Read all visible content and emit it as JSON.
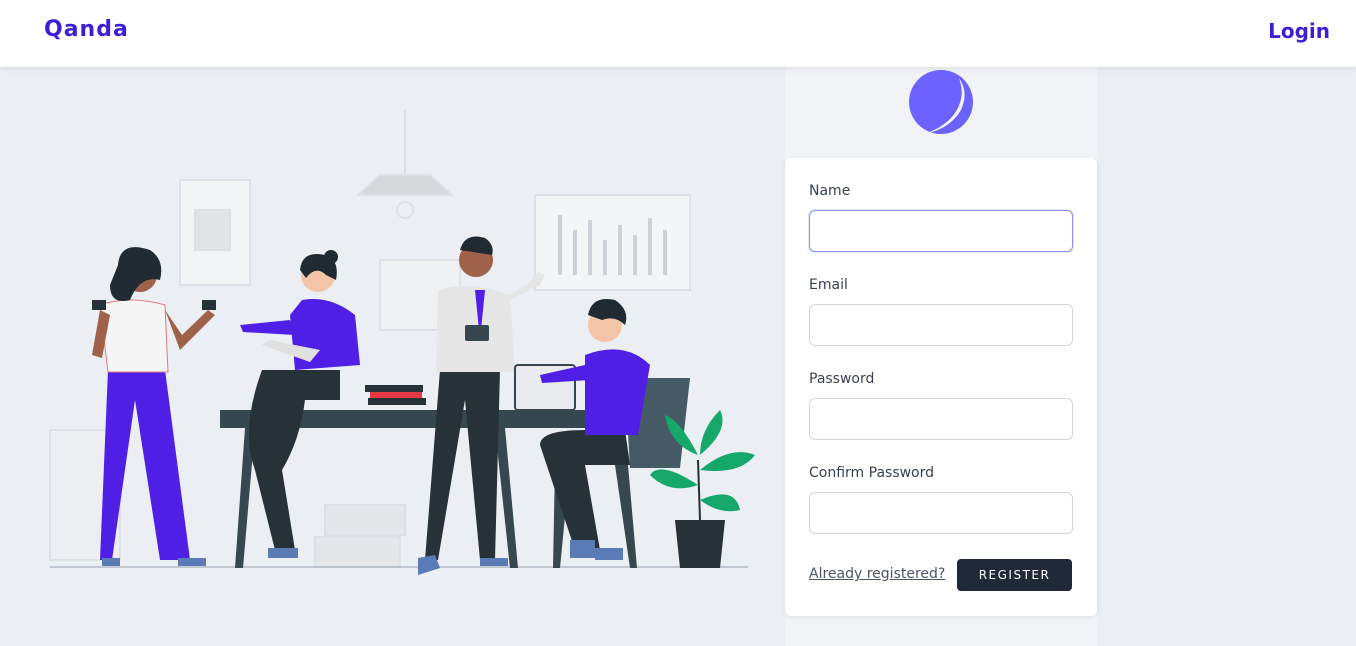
{
  "navbar": {
    "brand": "Qanda",
    "login_label": "Login"
  },
  "form": {
    "fields": [
      {
        "label": "Name",
        "value": ""
      },
      {
        "label": "Email",
        "value": ""
      },
      {
        "label": "Password",
        "value": ""
      },
      {
        "label": "Confirm Password",
        "value": ""
      }
    ],
    "already_registered_label": "Already registered?",
    "register_label": "REGISTER"
  },
  "colors": {
    "brand": "#3b1fd6",
    "accent_purple": "#4f1fe6",
    "logo": "#6c63ff",
    "button": "#1f2937"
  }
}
